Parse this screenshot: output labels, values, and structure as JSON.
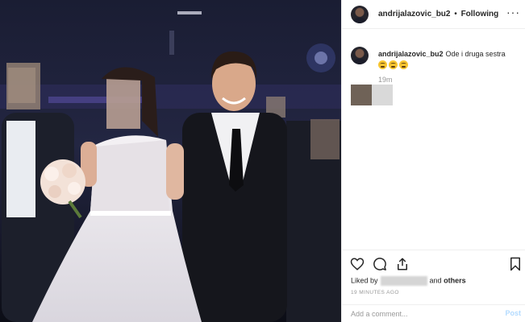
{
  "post": {
    "username": "andrijalazovic_bu2",
    "follow_separator": "•",
    "follow_status": "Following",
    "more_icon": "more-options-icon"
  },
  "caption": {
    "username": "andrijalazovic_bu2",
    "text": "Ode i druga sestra",
    "emojis": [
      "crying-face",
      "crying-face",
      "crying-face"
    ],
    "time": "19m"
  },
  "actions": {
    "icons": [
      "heart-icon",
      "comment-icon",
      "share-icon",
      "bookmark-icon"
    ]
  },
  "likes": {
    "prefix": "Liked by",
    "conjunction": "and",
    "suffix": "others"
  },
  "post_time": "19 MINUTES AGO",
  "add_comment": {
    "placeholder": "Add a comment...",
    "post_label": "Post"
  },
  "colors": {
    "text": "#262626",
    "muted": "#999999",
    "post_button_disabled": "#b3dbff"
  }
}
